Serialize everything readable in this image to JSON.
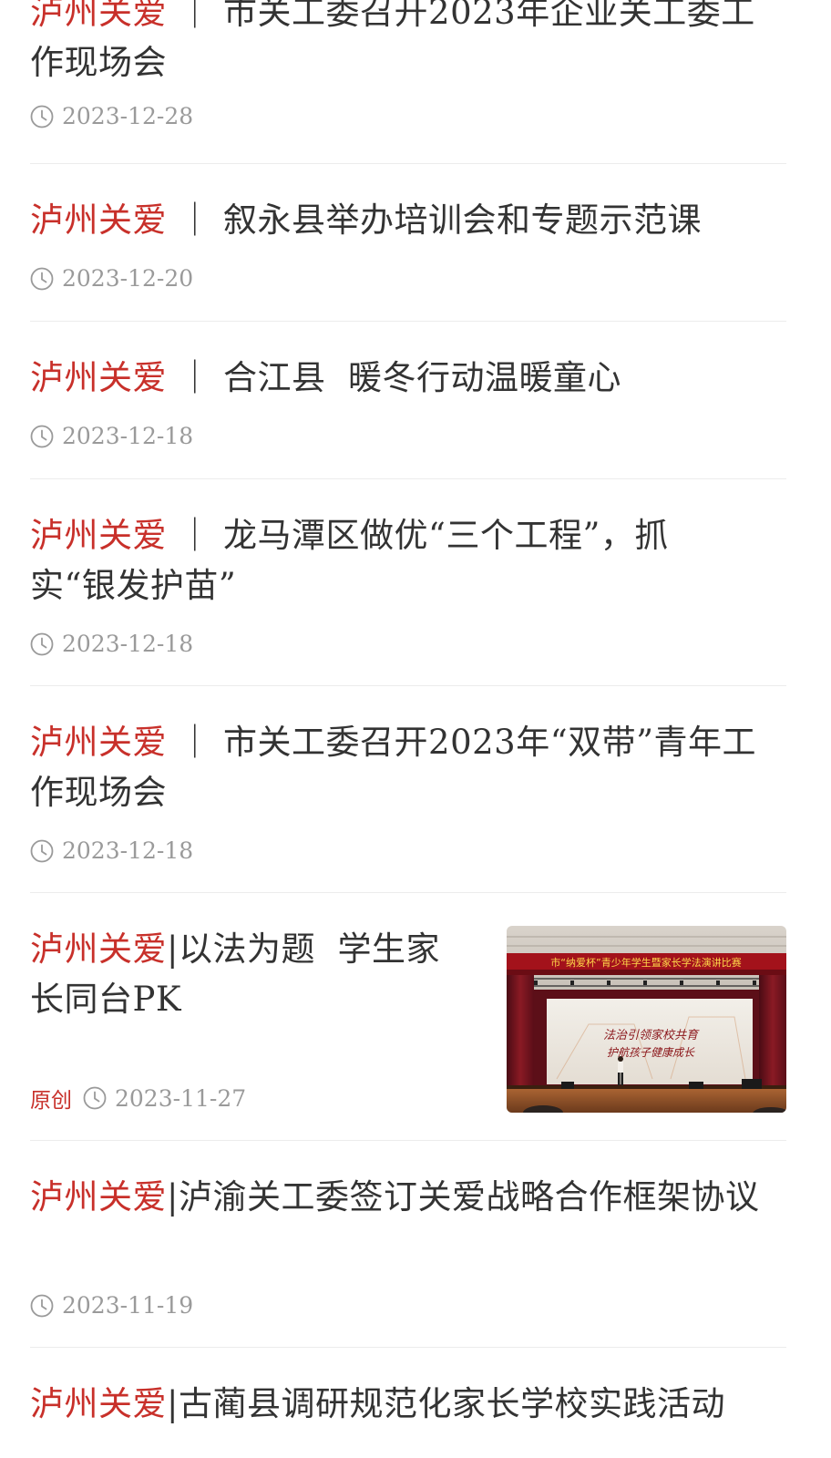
{
  "items": [
    {
      "brand": "泸州关爱",
      "sep": "｜",
      "title": "市关工委召开2023年企业关工委工作现场会",
      "date": "2023-12-28"
    },
    {
      "brand": "泸州关爱",
      "sep": "｜",
      "title": "叙永县举办培训会和专题示范课",
      "date": "2023-12-20"
    },
    {
      "brand": "泸州关爱",
      "sep": "｜",
      "title": "合江县  暖冬行动温暖童心",
      "date": "2023-12-18"
    },
    {
      "brand": "泸州关爱",
      "sep": "｜",
      "title": "龙马潭区做优“三个工程”，抓实“银发护苗”",
      "date": "2023-12-18"
    },
    {
      "brand": "泸州关爱",
      "sep": "｜",
      "title": "市关工委召开2023年“双带”青年工作现场会",
      "date": "2023-12-18"
    },
    {
      "brand": "泸州关爱",
      "sep": "|",
      "title": "以法为题  学生家长同台PK",
      "tag": "原创",
      "date": "2023-11-27",
      "image": {
        "banner": "市“纳爱杯”青少年学生暨家长学法演讲比赛",
        "screen_line1": "法治引领家校共育",
        "screen_line2": "护航孩子健康成长"
      }
    },
    {
      "brand": "泸州关爱",
      "sep": "|",
      "title": "泸渝关工委签订关爱战略合作框架协议",
      "date": "2023-11-19"
    },
    {
      "brand": "泸州关爱",
      "sep": "|",
      "title": "古蔺县调研规范化家长学校实践活动",
      "date": ""
    }
  ],
  "colors": {
    "brand": "#c8302a",
    "text": "#333333",
    "meta": "#9a9a9a",
    "divider": "#ececec"
  },
  "icons": {
    "date": "clock-icon"
  }
}
